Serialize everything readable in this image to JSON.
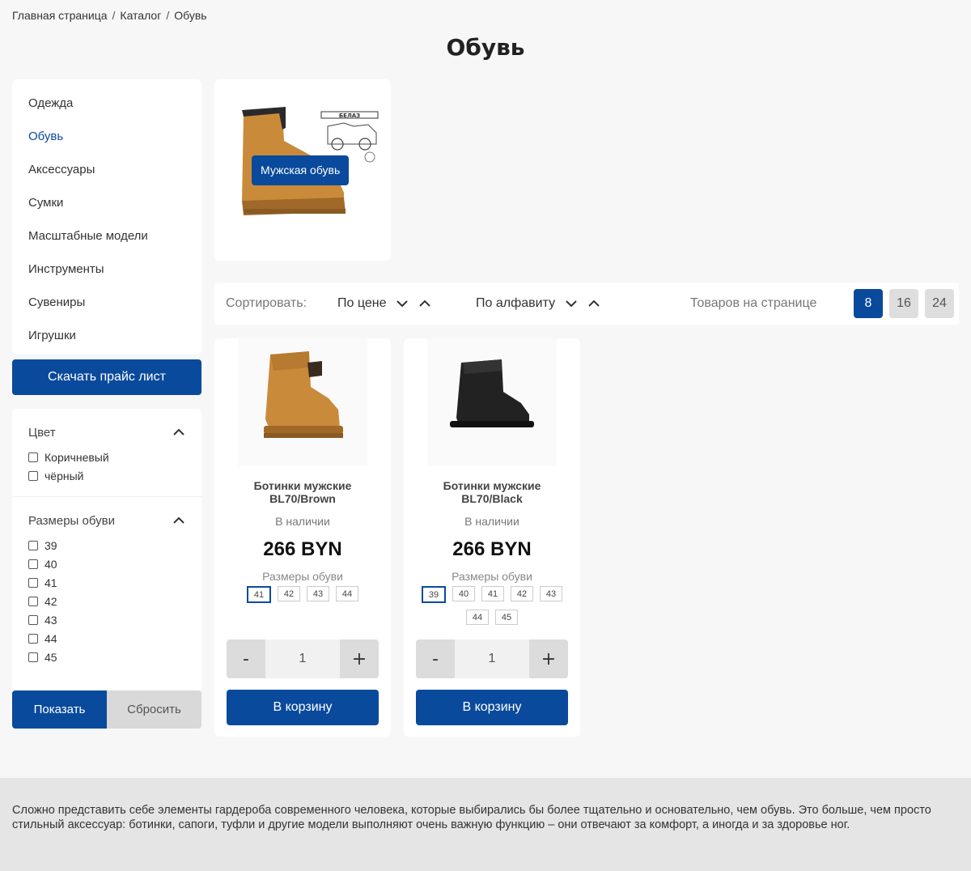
{
  "breadcrumb": {
    "home": "Главная страница",
    "catalog": "Каталог",
    "current": "Обувь",
    "separator": "/"
  },
  "page_title": "Обувь",
  "categories": [
    {
      "label": "Одежда",
      "active": false
    },
    {
      "label": "Обувь",
      "active": true
    },
    {
      "label": "Аксессуары",
      "active": false
    },
    {
      "label": "Сумки",
      "active": false
    },
    {
      "label": "Масштабные модели",
      "active": false
    },
    {
      "label": "Инструменты",
      "active": false
    },
    {
      "label": "Сувениры",
      "active": false
    },
    {
      "label": "Игрушки",
      "active": false
    }
  ],
  "price_list_button": "Скачать прайс лист",
  "filters": {
    "color": {
      "title": "Цвет",
      "options": [
        "Коричневый",
        "чёрный"
      ]
    },
    "sizes": {
      "title": "Размеры обуви",
      "options": [
        "39",
        "40",
        "41",
        "42",
        "43",
        "44",
        "45"
      ]
    },
    "show_button": "Показать",
    "reset_button": "Сбросить"
  },
  "subcategory": {
    "label": "Мужская обувь",
    "brand_text": "БЕЛАЗ"
  },
  "sort": {
    "label": "Сортировать:",
    "by_price": "По цене",
    "by_alpha": "По алфавиту",
    "per_page_label": "Товаров на странице",
    "per_page_options": [
      "8",
      "16",
      "24"
    ],
    "per_page_selected": "8"
  },
  "products": [
    {
      "name_line1": "Ботинки мужские",
      "name_line2": "BL70/Brown",
      "stock": "В наличии",
      "price": "266 BYN",
      "sizes_label": "Размеры обуви",
      "sizes": [
        "41",
        "42",
        "43",
        "44"
      ],
      "selected_size": "41",
      "quantity": "1",
      "minus": "-",
      "plus": "+",
      "cart_button": "В корзину",
      "color": "#c98a3a"
    },
    {
      "name_line1": "Ботинки мужские",
      "name_line2": "BL70/Black",
      "stock": "В наличии",
      "price": "266 BYN",
      "sizes_label": "Размеры обуви",
      "sizes": [
        "39",
        "40",
        "41",
        "42",
        "43",
        "44",
        "45"
      ],
      "selected_size": "39",
      "quantity": "1",
      "minus": "-",
      "plus": "+",
      "cart_button": "В корзину",
      "color": "#222222"
    }
  ],
  "description": "Сложно представить себе элементы гардероба современного человека, которые выбирались бы более тщательно и основательно, чем обувь. Это больше, чем просто стильный аксессуар: ботинки, сапоги, туфли и другие модели выполняют очень важную функцию – они отвечают за комфорт, а иногда и за здоровье ног.",
  "colors": {
    "accent": "#0a4a9c",
    "page_bg": "#f7f7f7",
    "footer_bg": "#e5e5e5"
  }
}
